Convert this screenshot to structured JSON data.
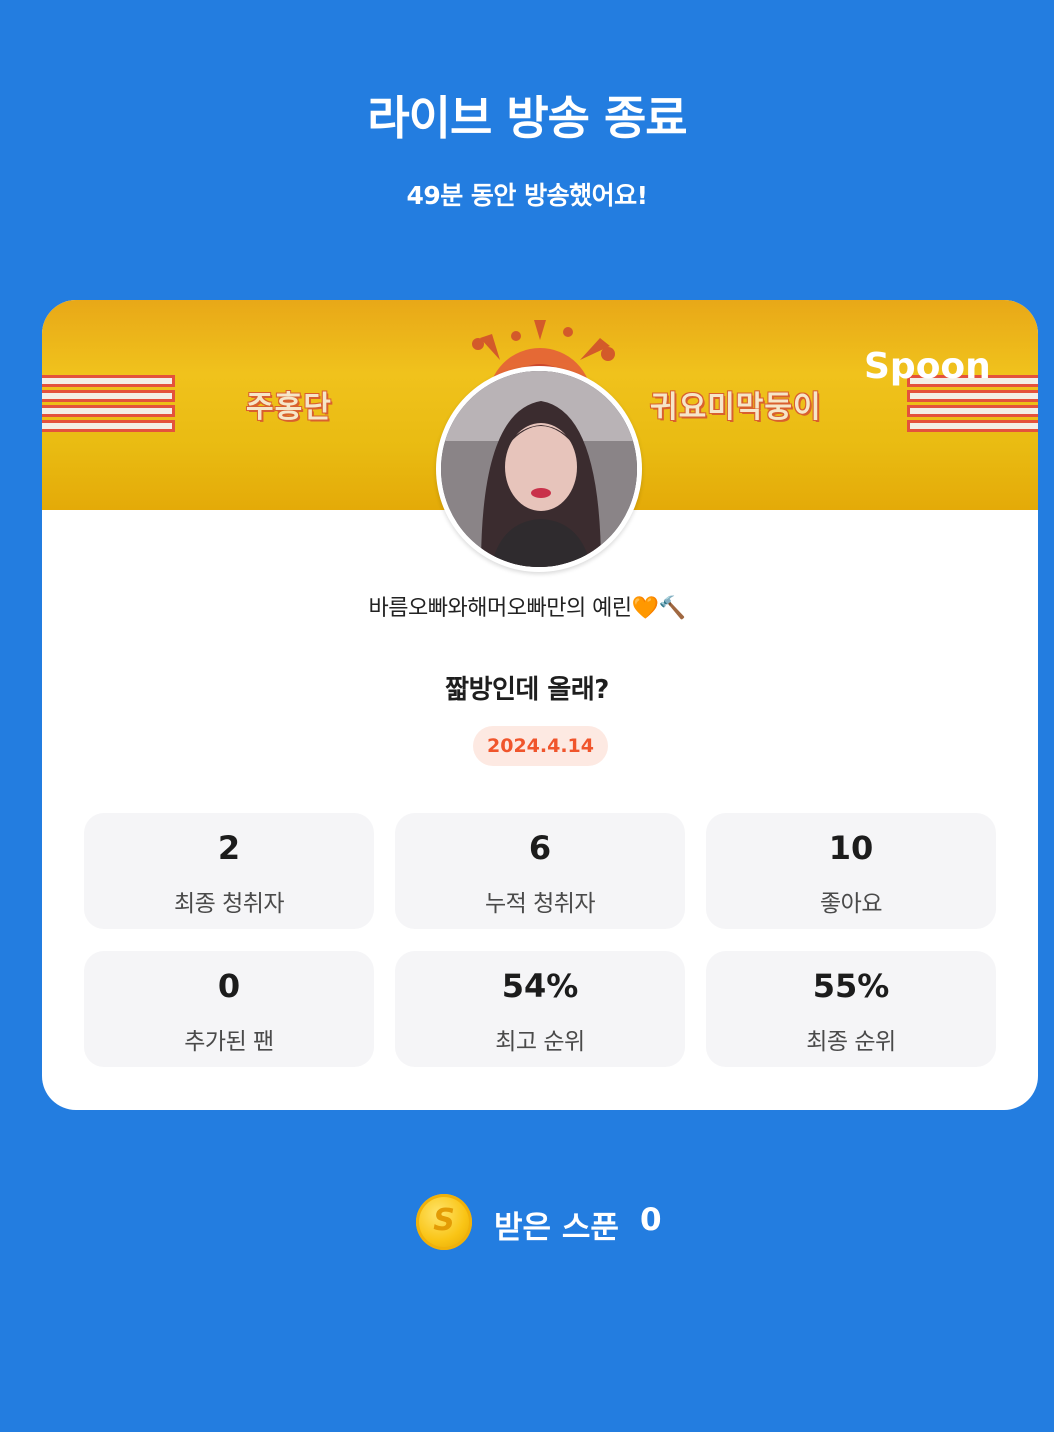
{
  "header": {
    "title": "라이브 방송 종료",
    "subtitle": "49분 동안 방송했어요!"
  },
  "banner": {
    "left_text": "주홍단",
    "right_text": "귀요미막둥이",
    "logo_text": "Spoon"
  },
  "profile": {
    "nickname": "바름오빠와해머오빠만의 예린🧡🔨",
    "broadcast_title": "짧방인데 올래?",
    "date": "2024.4.14"
  },
  "stats": [
    {
      "value": "2",
      "label": "최종 청취자"
    },
    {
      "value": "6",
      "label": "누적 청취자"
    },
    {
      "value": "10",
      "label": "좋아요"
    },
    {
      "value": "0",
      "label": "추가된 팬"
    },
    {
      "value": "54%",
      "label": "최고 순위"
    },
    {
      "value": "55%",
      "label": "최종 순위"
    }
  ],
  "spoons": {
    "icon": "spoon-coin-icon",
    "coin_letter": "S",
    "label": "받은 스푼",
    "value": "0"
  },
  "colors": {
    "background": "#237de0",
    "card": "#ffffff",
    "banner": "#f0c21c",
    "date_badge_bg": "#fde9e2",
    "date_badge_text": "#f0552c",
    "stat_bg": "#f5f5f7",
    "coin": "#f9c415"
  }
}
